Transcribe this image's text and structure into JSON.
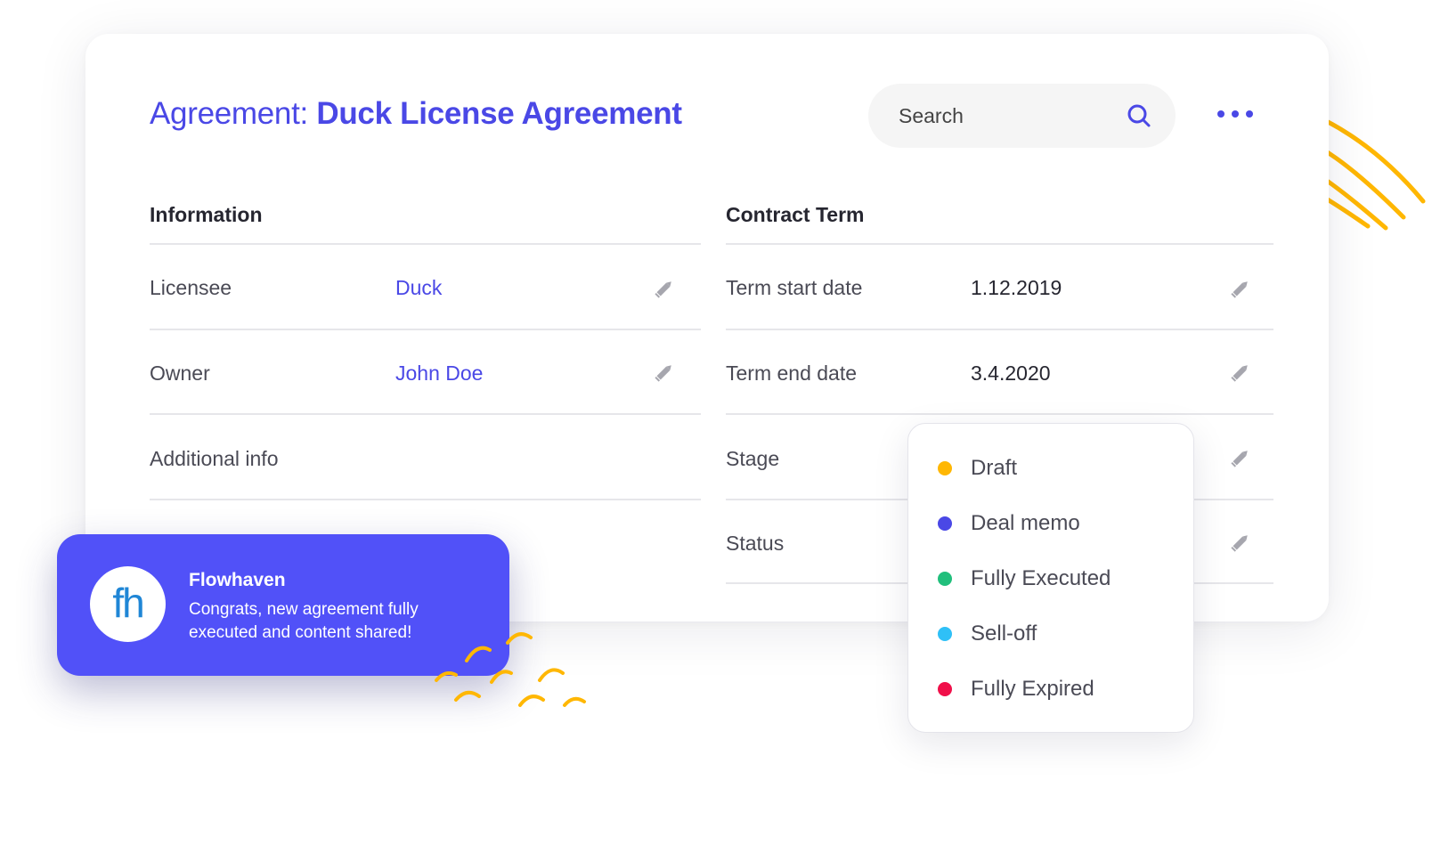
{
  "header": {
    "title_prefix": "Agreement:",
    "title_name": "Duck License Agreement"
  },
  "search": {
    "placeholder": "Search"
  },
  "information": {
    "heading": "Information",
    "rows": [
      {
        "label": "Licensee",
        "value": "Duck"
      },
      {
        "label": "Owner",
        "value": "John Doe"
      },
      {
        "label": "Additional info",
        "value": ""
      }
    ]
  },
  "contract_term": {
    "heading": "Contract Term",
    "rows": [
      {
        "label": "Term start date",
        "value": "1.12.2019"
      },
      {
        "label": "Term end date",
        "value": "3.4.2020"
      },
      {
        "label": "Stage",
        "value": ""
      },
      {
        "label": "Status",
        "value": ""
      }
    ]
  },
  "stage_dropdown": {
    "options": [
      {
        "label": "Draft",
        "color": "#ffb703"
      },
      {
        "label": "Deal memo",
        "color": "#4a48e6"
      },
      {
        "label": "Fully Executed",
        "color": "#21bf7c"
      },
      {
        "label": "Sell-off",
        "color": "#2fc0f7"
      },
      {
        "label": "Fully Expired",
        "color": "#f0104a"
      }
    ]
  },
  "notification": {
    "app_name": "Flowhaven",
    "message": "Congrats, new agreement fully executed and content shared!",
    "logo_text": "fh"
  },
  "colors": {
    "accent": "#4a48e6",
    "toast": "#5151f8",
    "decoration": "#ffb703"
  }
}
